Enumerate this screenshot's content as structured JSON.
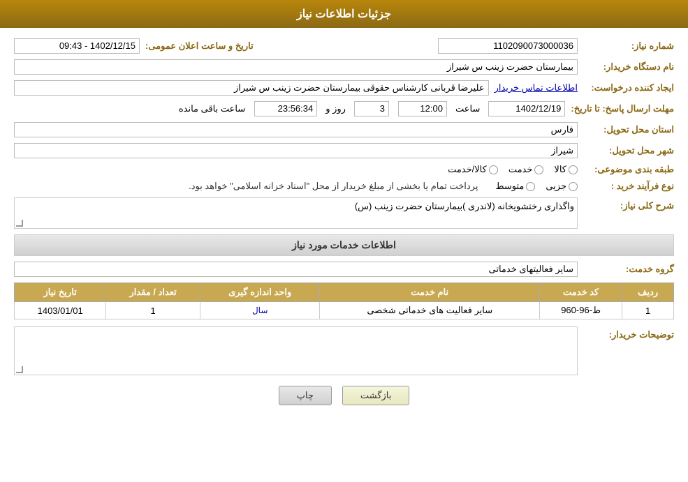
{
  "header": {
    "title": "جزئیات اطلاعات نیاز"
  },
  "need_number": {
    "label": "شماره نیاز:",
    "value": "1102090073000036"
  },
  "announcement_date": {
    "label": "تاریخ و ساعت اعلان عمومی:",
    "value": "1402/12/15 - 09:43"
  },
  "buyer_org": {
    "label": "نام دستگاه خریدار:",
    "value": "بیمارستان حضرت زینب  س  شیراز"
  },
  "creator": {
    "label": "ایجاد کننده درخواست:",
    "value": "علیرضا قربانی کارشناس حقوقی بیمارستان حضرت زینب  س  شیراز",
    "link_text": "اطلاعات تماس خریدار"
  },
  "deadline": {
    "label": "مهلت ارسال پاسخ: تا تاریخ:",
    "date": "1402/12/19",
    "time_label": "ساعت",
    "time_value": "12:00",
    "day_label": "روز و",
    "day_value": "3",
    "remaining_label": "ساعت باقی مانده",
    "remaining_value": "23:56:34"
  },
  "province": {
    "label": "استان محل تحویل:",
    "value": "فارس"
  },
  "city": {
    "label": "شهر محل تحویل:",
    "value": "شیراز"
  },
  "category": {
    "label": "طبقه بندی موضوعی:",
    "options": [
      {
        "label": "کالا",
        "selected": false
      },
      {
        "label": "خدمت",
        "selected": false
      },
      {
        "label": "کالا/خدمت",
        "selected": false
      }
    ]
  },
  "purchase_type": {
    "label": "نوع فرآیند خرید :",
    "note": "پرداخت تمام یا بخشی از مبلغ خریدار از محل \"اسناد خزانه اسلامی\" خواهد بود.",
    "options": [
      {
        "label": "جزیی",
        "selected": false
      },
      {
        "label": "متوسط",
        "selected": false
      }
    ]
  },
  "need_description": {
    "section_title": "شرح کلی نیاز:",
    "value": "واگذاری رختشویخانه (لاندری )بیمارستان حضرت زینب (س)"
  },
  "services_section": {
    "title": "اطلاعات خدمات مورد نیاز",
    "service_group_label": "گروه خدمت:",
    "service_group_value": "سایر فعالیتهای خدماتی",
    "table": {
      "headers": [
        "ردیف",
        "کد خدمت",
        "نام خدمت",
        "واحد اندازه گیری",
        "تعداد / مقدار",
        "تاریخ نیاز"
      ],
      "rows": [
        {
          "row_num": "1",
          "service_code": "ط-96-960",
          "service_name": "سایر فعالیت های خدماتی شخصی",
          "unit": "سال",
          "quantity": "1",
          "date": "1403/01/01"
        }
      ]
    }
  },
  "buyer_notes": {
    "label": "توضیحات خریدار:",
    "value": ""
  },
  "buttons": {
    "print": "چاپ",
    "back": "بازگشت"
  }
}
